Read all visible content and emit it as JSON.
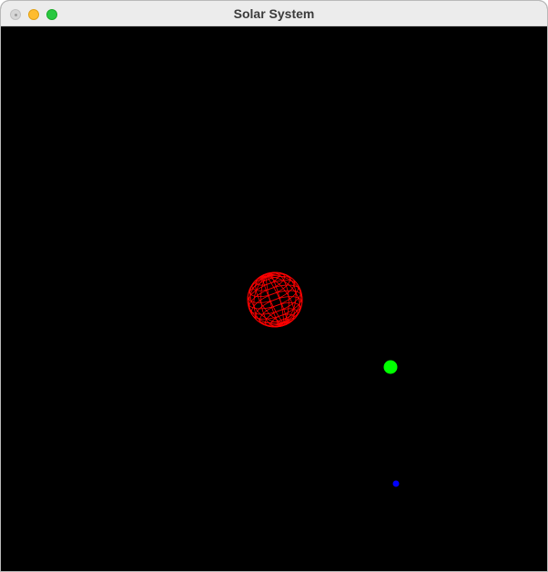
{
  "window": {
    "title": "Solar System"
  },
  "scene": {
    "background_color": "#000000",
    "bodies": [
      {
        "name": "sun",
        "render_style": "wireframe-sphere",
        "color": "#ff0000"
      },
      {
        "name": "planet",
        "render_style": "solid-sphere",
        "color": "#00ff00"
      },
      {
        "name": "moon",
        "render_style": "solid-sphere",
        "color": "#0000ff"
      }
    ]
  }
}
